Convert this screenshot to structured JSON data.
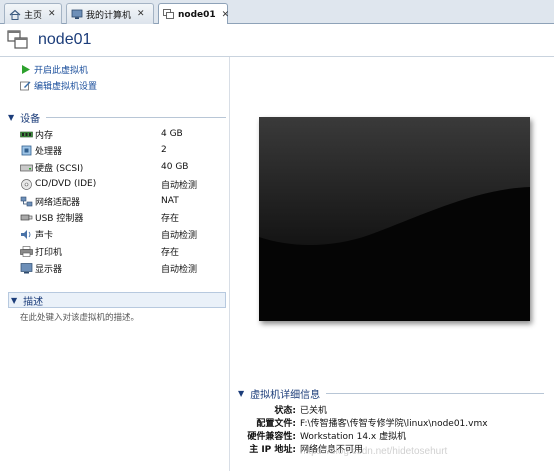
{
  "tabs": [
    {
      "label": "主页",
      "icon": "home-icon"
    },
    {
      "label": "我的计算机",
      "icon": "computer-icon"
    },
    {
      "label": "node01",
      "icon": "vm-icon"
    }
  ],
  "header": {
    "title": "node01",
    "icon": "vm-icon"
  },
  "actions": [
    {
      "label": "开启此虚拟机",
      "icon": "play-icon"
    },
    {
      "label": "编辑虚拟机设置",
      "icon": "edit-icon"
    }
  ],
  "devices_section": {
    "title": "设备"
  },
  "devices": [
    {
      "name": "内存",
      "value": "4 GB",
      "icon": "memory-icon"
    },
    {
      "name": "处理器",
      "value": "2",
      "icon": "cpu-icon"
    },
    {
      "name": "硬盘 (SCSI)",
      "value": "40 GB",
      "icon": "hard-disk-icon"
    },
    {
      "name": "CD/DVD (IDE)",
      "value": "自动检测",
      "icon": "cd-dvd-icon"
    },
    {
      "name": "网络适配器",
      "value": "NAT",
      "icon": "network-icon"
    },
    {
      "name": "USB 控制器",
      "value": "存在",
      "icon": "usb-icon"
    },
    {
      "name": "声卡",
      "value": "自动检测",
      "icon": "sound-icon"
    },
    {
      "name": "打印机",
      "value": "存在",
      "icon": "printer-icon"
    },
    {
      "name": "显示器",
      "value": "自动检测",
      "icon": "display-icon"
    }
  ],
  "description_section": {
    "title": "描述",
    "placeholder": "在此处键入对该虚拟机的描述。"
  },
  "details": {
    "title": "虚拟机详细信息",
    "rows": [
      {
        "key": "状态:",
        "value": "已关机"
      },
      {
        "key": "配置文件:",
        "value": "F:\\传智播客\\传智专修学院\\linux\\node01.vmx"
      },
      {
        "key": "硬件兼容性:",
        "value": "Workstation 14.x 虚拟机"
      },
      {
        "key": "主 IP 地址:",
        "value": "网络信息不可用"
      }
    ]
  },
  "watermark": "https://blog.csdn.net/hidetosehurt",
  "colors": {
    "accent": "#1c3d7a",
    "link": "#1b4f9c",
    "preview_bg": "#050505"
  }
}
